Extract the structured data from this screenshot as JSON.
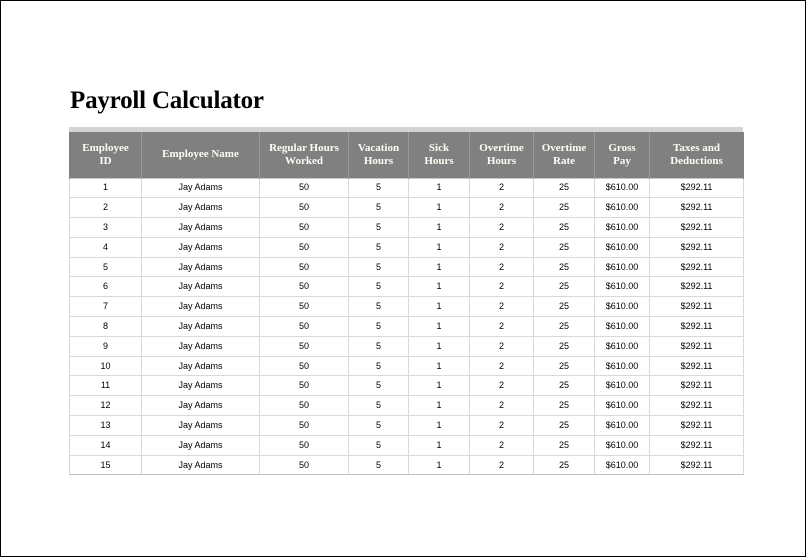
{
  "document": {
    "title": "Payroll Calculator"
  },
  "table": {
    "columns": [
      {
        "key": "employee_id",
        "label": "Employee\nID"
      },
      {
        "key": "employee_name",
        "label": "Employee Name"
      },
      {
        "key": "regular_hours_worked",
        "label": "Regular Hours\nWorked"
      },
      {
        "key": "vacation_hours",
        "label": "Vacation\nHours"
      },
      {
        "key": "sick_hours",
        "label": "Sick\nHours"
      },
      {
        "key": "overtime_hours",
        "label": "Overtime\nHours"
      },
      {
        "key": "overtime_rate",
        "label": "Overtime\nRate"
      },
      {
        "key": "gross_pay",
        "label": "Gross\nPay"
      },
      {
        "key": "taxes_and_deductions",
        "label": "Taxes and\nDeductions"
      }
    ],
    "rows": [
      [
        "1",
        "Jay Adams",
        "50",
        "5",
        "1",
        "2",
        "25",
        "$610.00",
        "$292.11"
      ],
      [
        "2",
        "Jay Adams",
        "50",
        "5",
        "1",
        "2",
        "25",
        "$610.00",
        "$292.11"
      ],
      [
        "3",
        "Jay Adams",
        "50",
        "5",
        "1",
        "2",
        "25",
        "$610.00",
        "$292.11"
      ],
      [
        "4",
        "Jay Adams",
        "50",
        "5",
        "1",
        "2",
        "25",
        "$610.00",
        "$292.11"
      ],
      [
        "5",
        "Jay Adams",
        "50",
        "5",
        "1",
        "2",
        "25",
        "$610.00",
        "$292.11"
      ],
      [
        "6",
        "Jay Adams",
        "50",
        "5",
        "1",
        "2",
        "25",
        "$610.00",
        "$292.11"
      ],
      [
        "7",
        "Jay Adams",
        "50",
        "5",
        "1",
        "2",
        "25",
        "$610.00",
        "$292.11"
      ],
      [
        "8",
        "Jay Adams",
        "50",
        "5",
        "1",
        "2",
        "25",
        "$610.00",
        "$292.11"
      ],
      [
        "9",
        "Jay Adams",
        "50",
        "5",
        "1",
        "2",
        "25",
        "$610.00",
        "$292.11"
      ],
      [
        "10",
        "Jay Adams",
        "50",
        "5",
        "1",
        "2",
        "25",
        "$610.00",
        "$292.11"
      ],
      [
        "11",
        "Jay Adams",
        "50",
        "5",
        "1",
        "2",
        "25",
        "$610.00",
        "$292.11"
      ],
      [
        "12",
        "Jay Adams",
        "50",
        "5",
        "1",
        "2",
        "25",
        "$610.00",
        "$292.11"
      ],
      [
        "13",
        "Jay Adams",
        "50",
        "5",
        "1",
        "2",
        "25",
        "$610.00",
        "$292.11"
      ],
      [
        "14",
        "Jay Adams",
        "50",
        "5",
        "1",
        "2",
        "25",
        "$610.00",
        "$292.11"
      ],
      [
        "15",
        "Jay Adams",
        "50",
        "5",
        "1",
        "2",
        "25",
        "$610.00",
        "$292.11"
      ]
    ]
  },
  "colors": {
    "header_background": "#808080",
    "header_text": "#fdfdf5",
    "top_strip": "#d4d4d4",
    "cell_border": "#d9d9d9",
    "page_border": "#000000",
    "body_text": "#000000",
    "page_background": "#ffffff"
  }
}
